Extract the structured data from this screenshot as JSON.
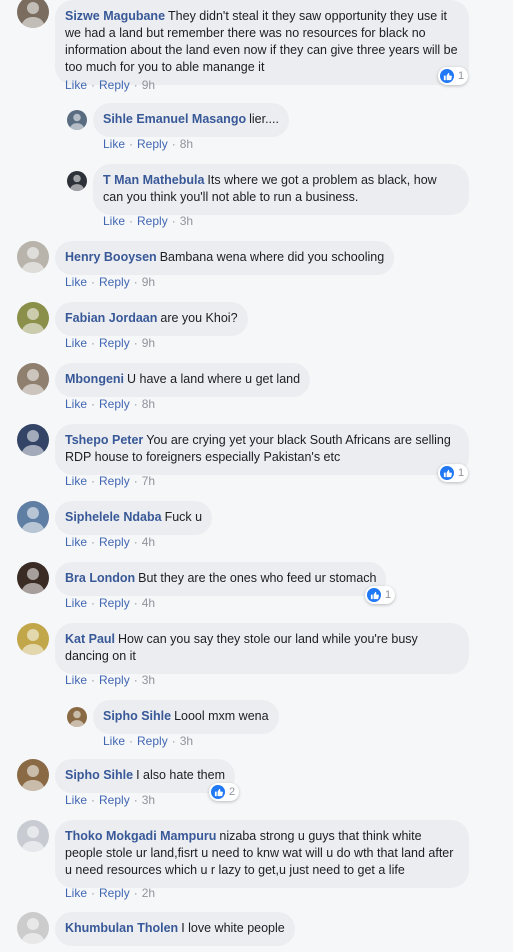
{
  "actions": {
    "like": "Like",
    "reply": "Reply",
    "sep": "·"
  },
  "comments": [
    {
      "name": "Sizwe Magubane",
      "text": "They didn't steal it they saw opportunity they use it we had a land but remember there was no resources for black no information about the land even now if they can give three years will be too much for you to able manange it",
      "time": "9h",
      "likes": "1",
      "avatar_color": "#7a6d60"
    },
    {
      "name": "Sihle Emanuel Masango",
      "text": "lier....",
      "time": "8h",
      "avatar_color": "#5a6c80"
    },
    {
      "name": "T Man Mathebula",
      "text": "Its where we got a problem as black, how can you think you'll not able to run a business.",
      "time": "3h",
      "avatar_color": "#2d3138"
    },
    {
      "name": "Henry Booysen",
      "text": "Bambana wena where did you schooling",
      "time": "9h",
      "avatar_color": "#b9b4ab"
    },
    {
      "name": "Fabian Jordaan",
      "text": "are you Khoi?",
      "time": "9h",
      "avatar_color": "#8a8f4a"
    },
    {
      "name": "Mbongeni",
      "text": "U have a land where u get land",
      "time": "8h",
      "avatar_color": "#8f7f6e"
    },
    {
      "name": "Tshepo Peter",
      "text": "You are crying yet your black South Africans are selling RDP house to foreigners especially Pakistan's etc",
      "time": "7h",
      "likes": "1",
      "avatar_color": "#334466"
    },
    {
      "name": "Siphelele Ndaba",
      "text": "Fuck u",
      "time": "4h",
      "avatar_color": "#5f7ea3"
    },
    {
      "name": "Bra London",
      "text": "But they are the ones who feed ur stomach",
      "time": "4h",
      "likes": "1",
      "avatar_color": "#3a2c24"
    },
    {
      "name": "Kat Paul",
      "text": "How can you say they stole our land while you're busy dancing on it",
      "time": "3h",
      "avatar_color": "#c2a64a"
    },
    {
      "name": "Sipho Sihle",
      "text": "Loool mxm wena",
      "time": "3h",
      "avatar_color": "#8a6a44"
    },
    {
      "name": "Sipho Sihle",
      "text": "I also hate them",
      "time": "3h",
      "likes": "2",
      "avatar_color": "#8a6a44"
    },
    {
      "name": "Thoko Mokgadi Mampuru",
      "text": "nizaba strong u guys that think white people stole ur land,fisrt u need to knw wat will u do wth that land after u need resources which u r lazy to get,u just need to get a life",
      "time": "2h",
      "avatar_color": "#c8ccd2"
    },
    {
      "name": "Khumbulan Tholen",
      "text": "I love white people"
    }
  ]
}
